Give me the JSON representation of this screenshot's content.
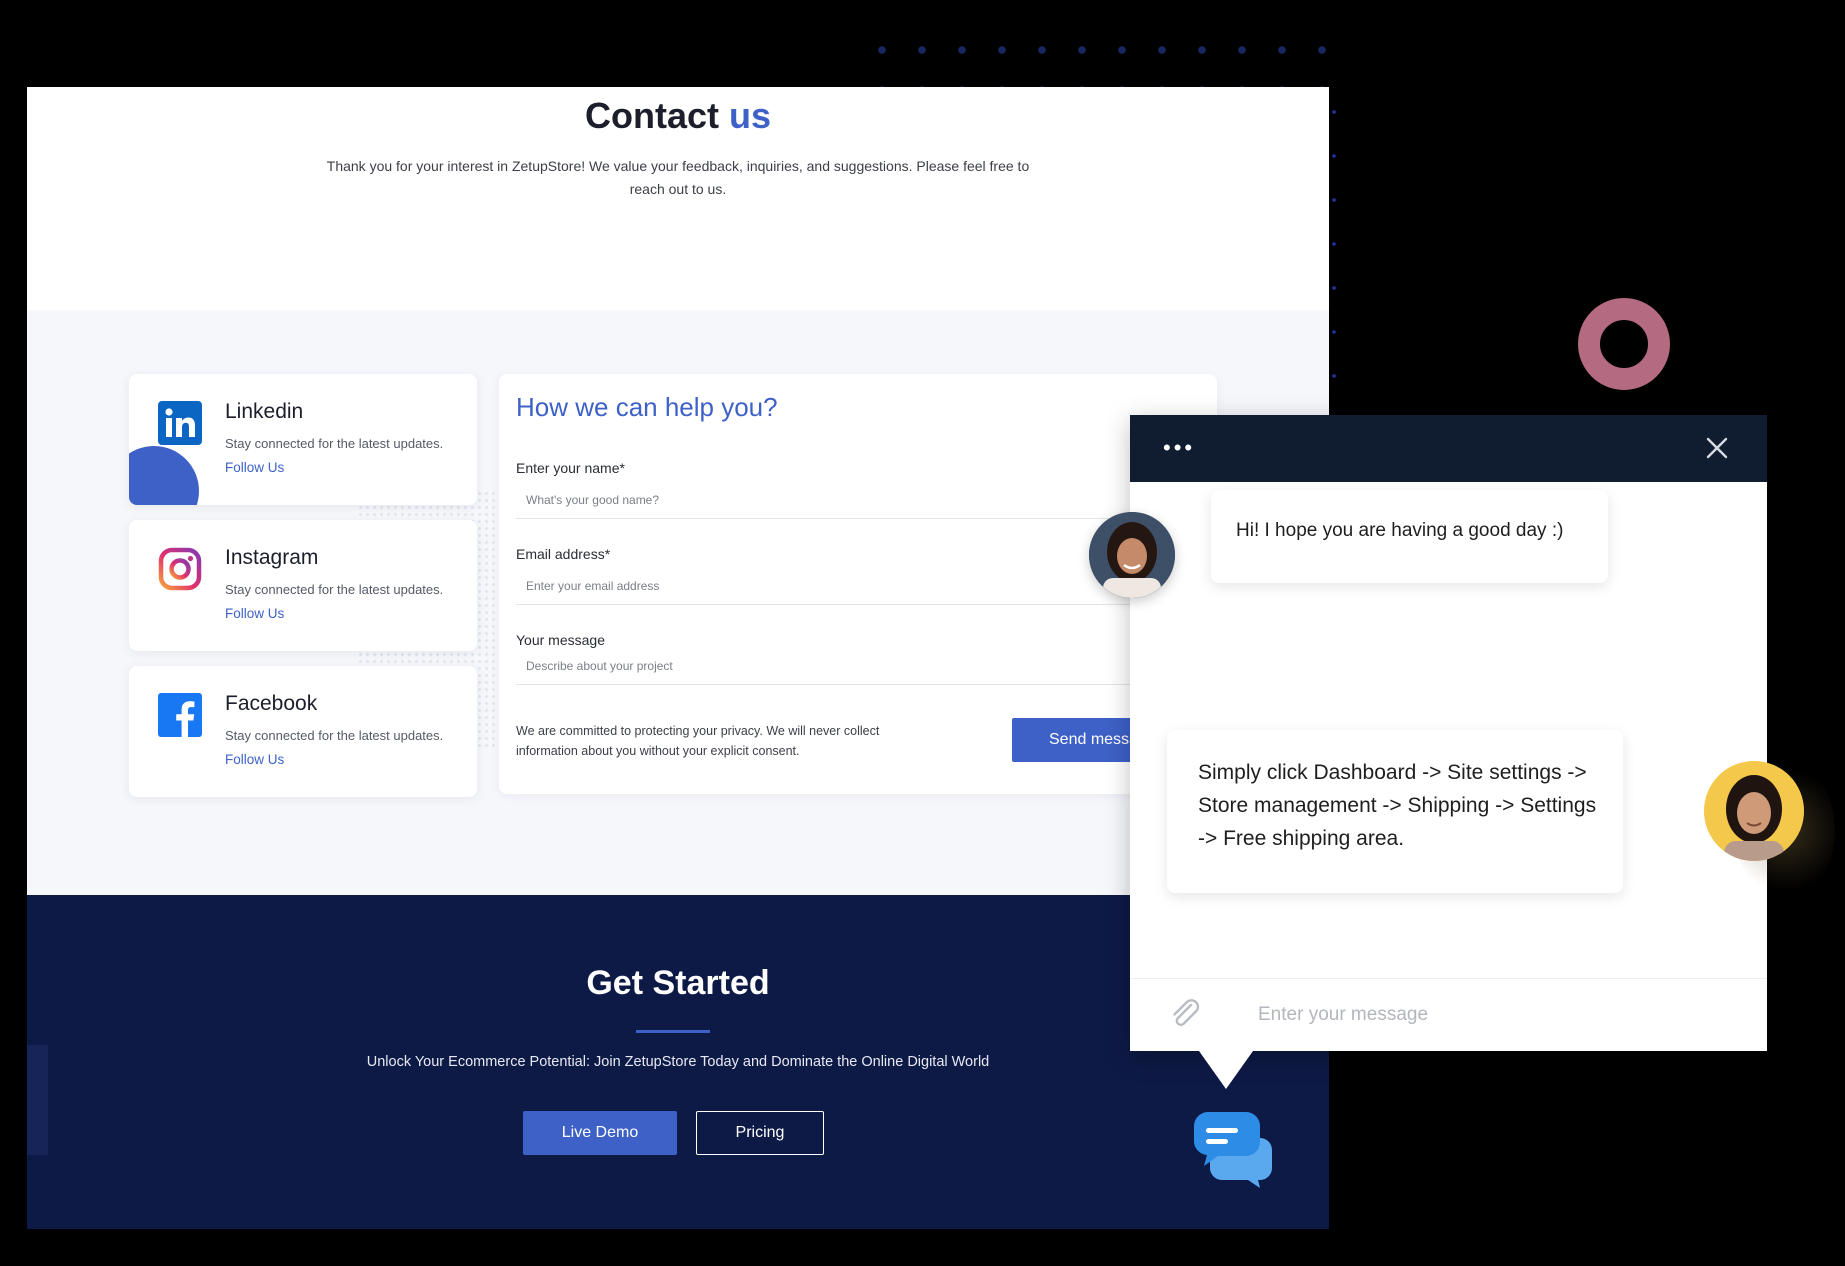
{
  "hero": {
    "title_main": "Contact",
    "title_accent": "us",
    "subtitle": "Thank you for your interest in ZetupStore! We value your feedback, inquiries, and suggestions. Please feel free to reach out to us."
  },
  "socials": [
    {
      "name": "Linkedin",
      "description": "Stay connected for the latest updates.",
      "link": "Follow Us",
      "icon": "linkedin-icon"
    },
    {
      "name": "Instagram",
      "description": "Stay connected for the latest updates.",
      "link": "Follow Us",
      "icon": "instagram-icon"
    },
    {
      "name": "Facebook",
      "description": "Stay connected for the latest updates.",
      "link": "Follow Us",
      "icon": "facebook-icon"
    }
  ],
  "form": {
    "title": "How we can help you?",
    "name_label": "Enter your name*",
    "name_placeholder": "What's your good name?",
    "email_label": "Email address*",
    "email_placeholder": "Enter your email address",
    "message_label": "Your message",
    "message_placeholder": "Describe about your project",
    "privacy": "We are committed to protecting your privacy. We will never collect information about you without your explicit consent.",
    "send_label": "Send message"
  },
  "cta": {
    "title": "Get Started",
    "subtitle": "Unlock Your Ecommerce Potential: Join ZetupStore Today and Dominate the Online Digital World",
    "demo_label": "Live Demo",
    "pricing_label": "Pricing"
  },
  "chat": {
    "menu_dots": "•••",
    "message_1": "Hi! I hope you are having a good day :)",
    "message_2": "Simply click Dashboard -> Site settings -> Store management -> Shipping -> Settings -> Free shipping area.",
    "input_placeholder": "Enter your message"
  },
  "colors": {
    "accent": "#3e61c8",
    "cta_background": "#0e1a46",
    "chat_header": "#101c30"
  }
}
